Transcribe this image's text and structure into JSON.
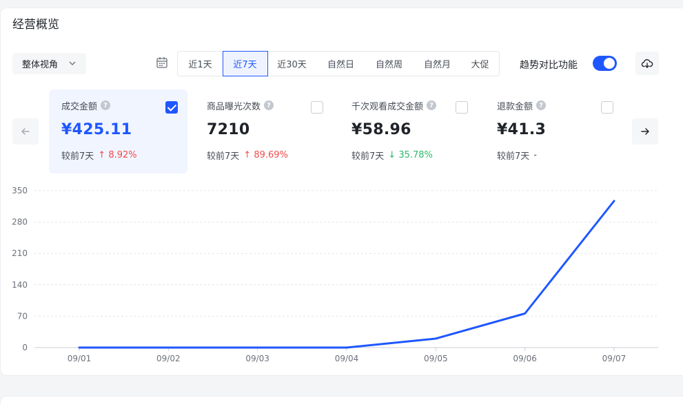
{
  "page_title": "经营概览",
  "view_select": {
    "value": "整体视角"
  },
  "date_options": [
    "近1天",
    "近7天",
    "近30天",
    "自然日",
    "自然周",
    "自然月",
    "大促"
  ],
  "date_active_index": 1,
  "trend_toggle": {
    "label": "趋势对比功能",
    "on": true
  },
  "metrics": [
    {
      "label": "成交金额",
      "value": "¥425.11",
      "compare_label": "较前7天",
      "change": "8.92%",
      "direction": "up",
      "checked": true,
      "active": true
    },
    {
      "label": "商品曝光次数",
      "value": "7210",
      "compare_label": "较前7天",
      "change": "89.69%",
      "direction": "up",
      "checked": false,
      "active": false
    },
    {
      "label": "千次观看成交金额",
      "value": "¥58.96",
      "compare_label": "较前7天",
      "change": "35.78%",
      "direction": "down",
      "checked": false,
      "active": false
    },
    {
      "label": "退款金额",
      "value": "¥41.3",
      "compare_label": "较前7天",
      "change": "-",
      "direction": "none",
      "checked": false,
      "active": false
    }
  ],
  "colors": {
    "accent": "#1f57ff",
    "up": "#f04a4a",
    "down": "#2bb96b"
  },
  "chart_data": {
    "type": "line",
    "categories": [
      "09/01",
      "09/02",
      "09/03",
      "09/04",
      "09/05",
      "09/06",
      "09/07"
    ],
    "series": [
      {
        "values": [
          0,
          0,
          0,
          0,
          20,
          76,
          327
        ],
        "color": "#1f57ff"
      }
    ],
    "yticks": [
      0,
      70,
      140,
      210,
      280,
      350
    ],
    "ylim": [
      0,
      350
    ],
    "grid": true
  }
}
